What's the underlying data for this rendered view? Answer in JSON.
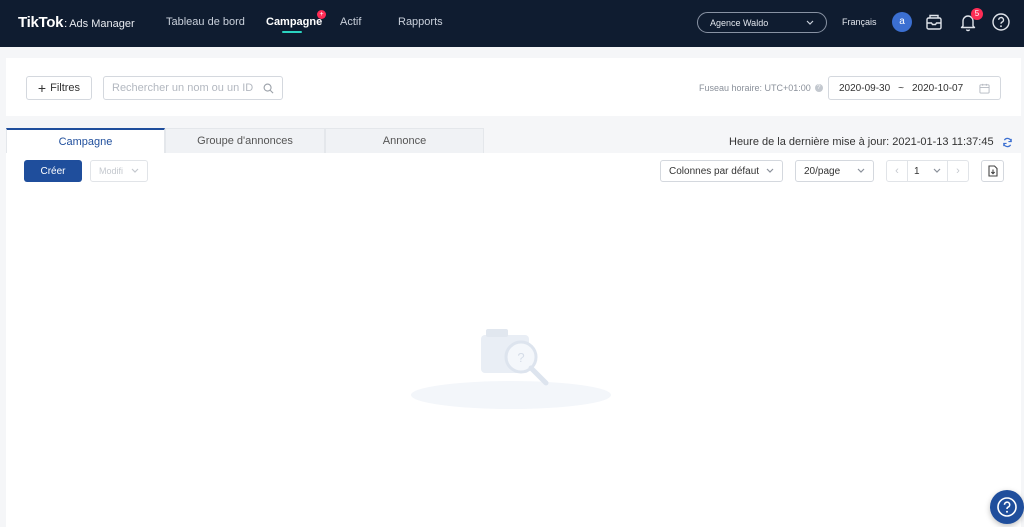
{
  "brand": {
    "name": "TikTok",
    "separator": ":",
    "product": "Ads Manager"
  },
  "nav": {
    "items": [
      {
        "label": "Tableau de bord"
      },
      {
        "label": "Campagne"
      },
      {
        "label": "Actif"
      },
      {
        "label": "Rapports"
      }
    ],
    "active": "Campagne"
  },
  "header": {
    "account": "Agence Waldo",
    "language": "Français",
    "avatar_initial": "a",
    "notification_count": "5"
  },
  "filters": {
    "filter_label": "Filtres",
    "search_placeholder": "Rechercher un nom ou un ID",
    "timezone": "Fuseau horaire: UTC+01:00",
    "date_start": "2020-09-30",
    "date_separator": "~",
    "date_end": "2020-10-07"
  },
  "tabs": [
    {
      "label": "Campagne"
    },
    {
      "label": "Groupe d'annonces"
    },
    {
      "label": "Annonce"
    }
  ],
  "last_update": "Heure de la dernière mise à jour: 2021-01-13 11:37:45",
  "toolbar": {
    "create_label": "Créer",
    "modify_label": "Modifi",
    "columns_label": "Colonnes par défaut",
    "page_size": "20/page",
    "current_page": "1"
  },
  "colors": {
    "nav_bg": "#0f1c30",
    "primary": "#1f4e9c",
    "accent": "#2bd3c0",
    "badge": "#fe2c55"
  }
}
